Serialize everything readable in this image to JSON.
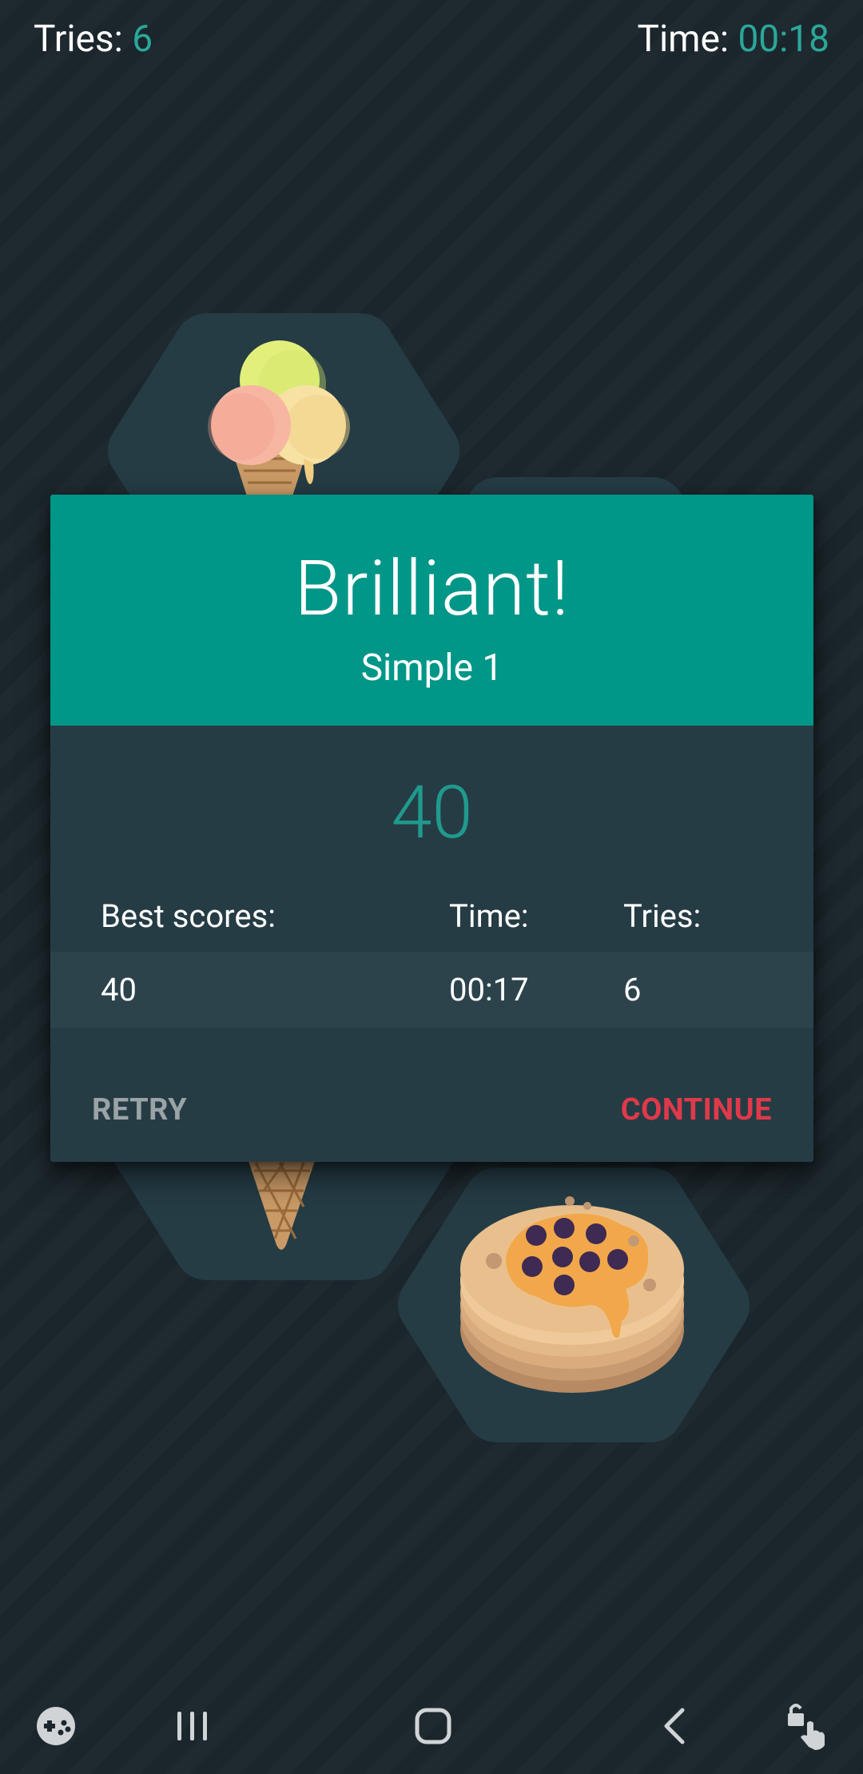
{
  "hud": {
    "tries_label": "Tries:",
    "tries_value": "6",
    "time_label": "Time:",
    "time_value": "00:18"
  },
  "tiles": [
    {
      "icon": "ice-cream-icon"
    },
    {
      "icon": "pancake-icon"
    }
  ],
  "dialog": {
    "title": "Brilliant!",
    "subtitle": "Simple 1",
    "score": "40",
    "table": {
      "headers": [
        "Best scores:",
        "Time:",
        "Tries:"
      ],
      "row": [
        "40",
        "00:17",
        "6"
      ]
    },
    "retry_label": "RETRY",
    "continue_label": "CONTINUE"
  },
  "navbar": {
    "items": [
      "game-launcher-icon",
      "recent-apps-icon",
      "home-icon",
      "back-icon",
      "touch-lock-icon"
    ]
  },
  "colors": {
    "background": "#1b262c",
    "tile": "#253c45",
    "accent": "#009688",
    "accent_text": "#2aa89a",
    "continue": "#e0394a",
    "retry": "#9aa3a6"
  }
}
